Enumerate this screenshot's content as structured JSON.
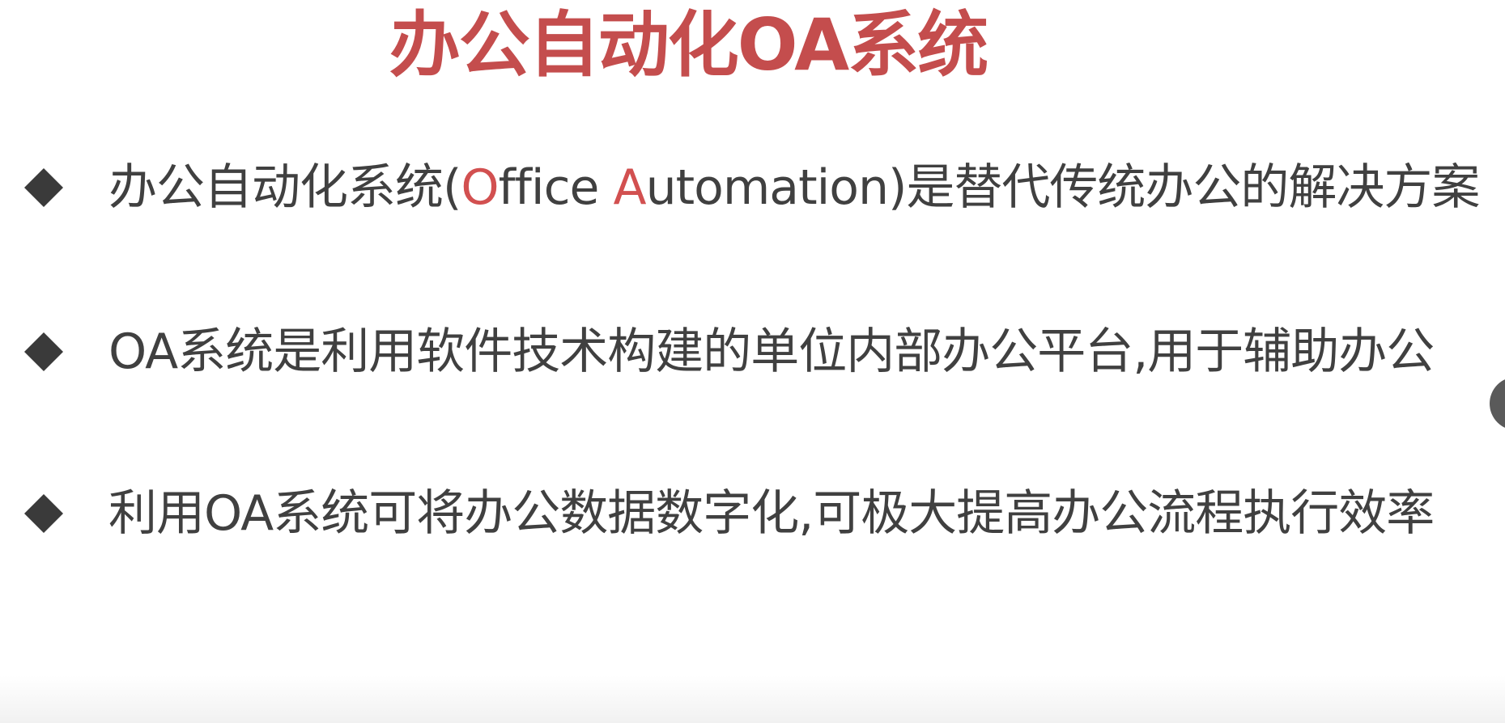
{
  "slide": {
    "title": "办公自动化OA系统",
    "title_color": "#c44d4d",
    "text_color": "#404040",
    "accent_color": "#d25050",
    "bullet_icon": "diamond-bullet-icon",
    "bullets": [
      {
        "pre": "办公自动化系统(",
        "h1": "O",
        "mid": "ffice ",
        "h2": "A",
        "post": "utomation)是替代传统办公的解决方案"
      },
      {
        "text": "OA系统是利用软件技术构建的单位内部办公平台,用于辅助办公"
      },
      {
        "text": "利用OA系统可将办公数据数字化,可极大提高办公流程执行效率"
      }
    ]
  },
  "viewer": {
    "edge_control_icon": "nav-circle-icon"
  }
}
